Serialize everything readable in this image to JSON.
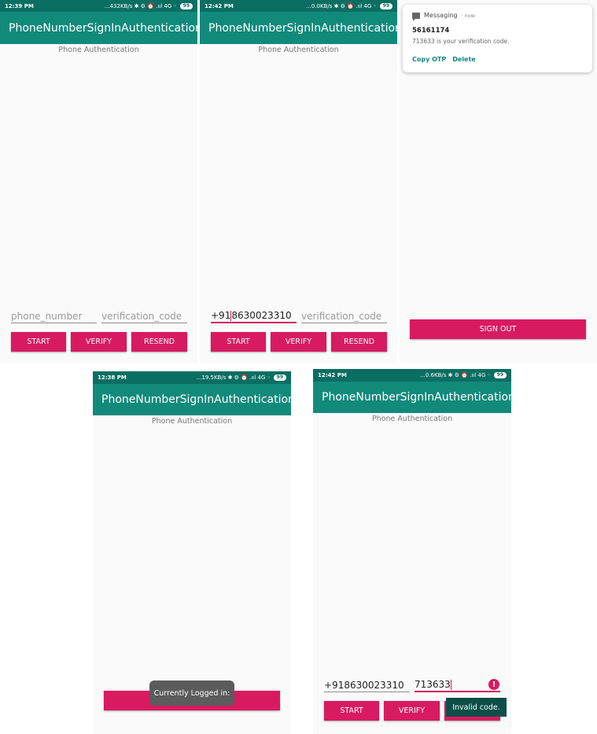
{
  "colors": {
    "statusbar": "#0b6e63",
    "appbar": "#128a7b",
    "accent": "#d81b60"
  },
  "screens": [
    {
      "status": {
        "time": "12:39 PM",
        "right": "...432KB/s ✱ ⚙ ⏰ .ııl 4G ◦",
        "battery": "99"
      },
      "app_title": "PhoneNumberSignInAuthentication",
      "subtitle": "Phone Authentication",
      "phone_placeholder": "phone_number",
      "code_placeholder": "verification_code",
      "start": "START",
      "verify": "VERIFY",
      "resend": "RESEND"
    },
    {
      "status": {
        "time": "12:42 PM",
        "right": "...0.0KB/s ✱ ⚙ ⏰ .ııl 4G ◦",
        "battery": "99"
      },
      "app_title": "PhoneNumberSignInAuthentication",
      "subtitle": "Phone Authentication",
      "phone_value_a": "+91",
      "phone_value_b": "8630023310",
      "code_placeholder": "verification_code",
      "start": "START",
      "verify": "VERIFY",
      "resend": "RESEND"
    },
    {
      "notification": {
        "app": "Messaging",
        "time": "· now",
        "sender": "56161174",
        "body": "713633 is your verification code.",
        "copy": "Copy OTP",
        "delete": "Delete"
      },
      "sign_out": "SIGN OUT"
    },
    {
      "status": {
        "time": "12:38 PM",
        "right": "...19.5KB/s ✱ ⚙ ⏰ .ııl 4G ◦",
        "battery": "99"
      },
      "app_title": "PhoneNumberSignInAuthentication",
      "subtitle": "Phone Authentication",
      "toast": "Currently Logged in:"
    },
    {
      "status": {
        "time": "12:42 PM",
        "right": "...0.6KB/s ✱ ⚙ ⏰ .ııl 4G ◦",
        "battery": "99"
      },
      "app_title": "PhoneNumberSignInAuthentication",
      "subtitle": "Phone Authentication",
      "phone_value": "+918630023310",
      "code_value": "713633",
      "error_message": "Invalid code.",
      "start": "START",
      "verify": "VERIFY",
      "resend": "RESEND"
    }
  ]
}
